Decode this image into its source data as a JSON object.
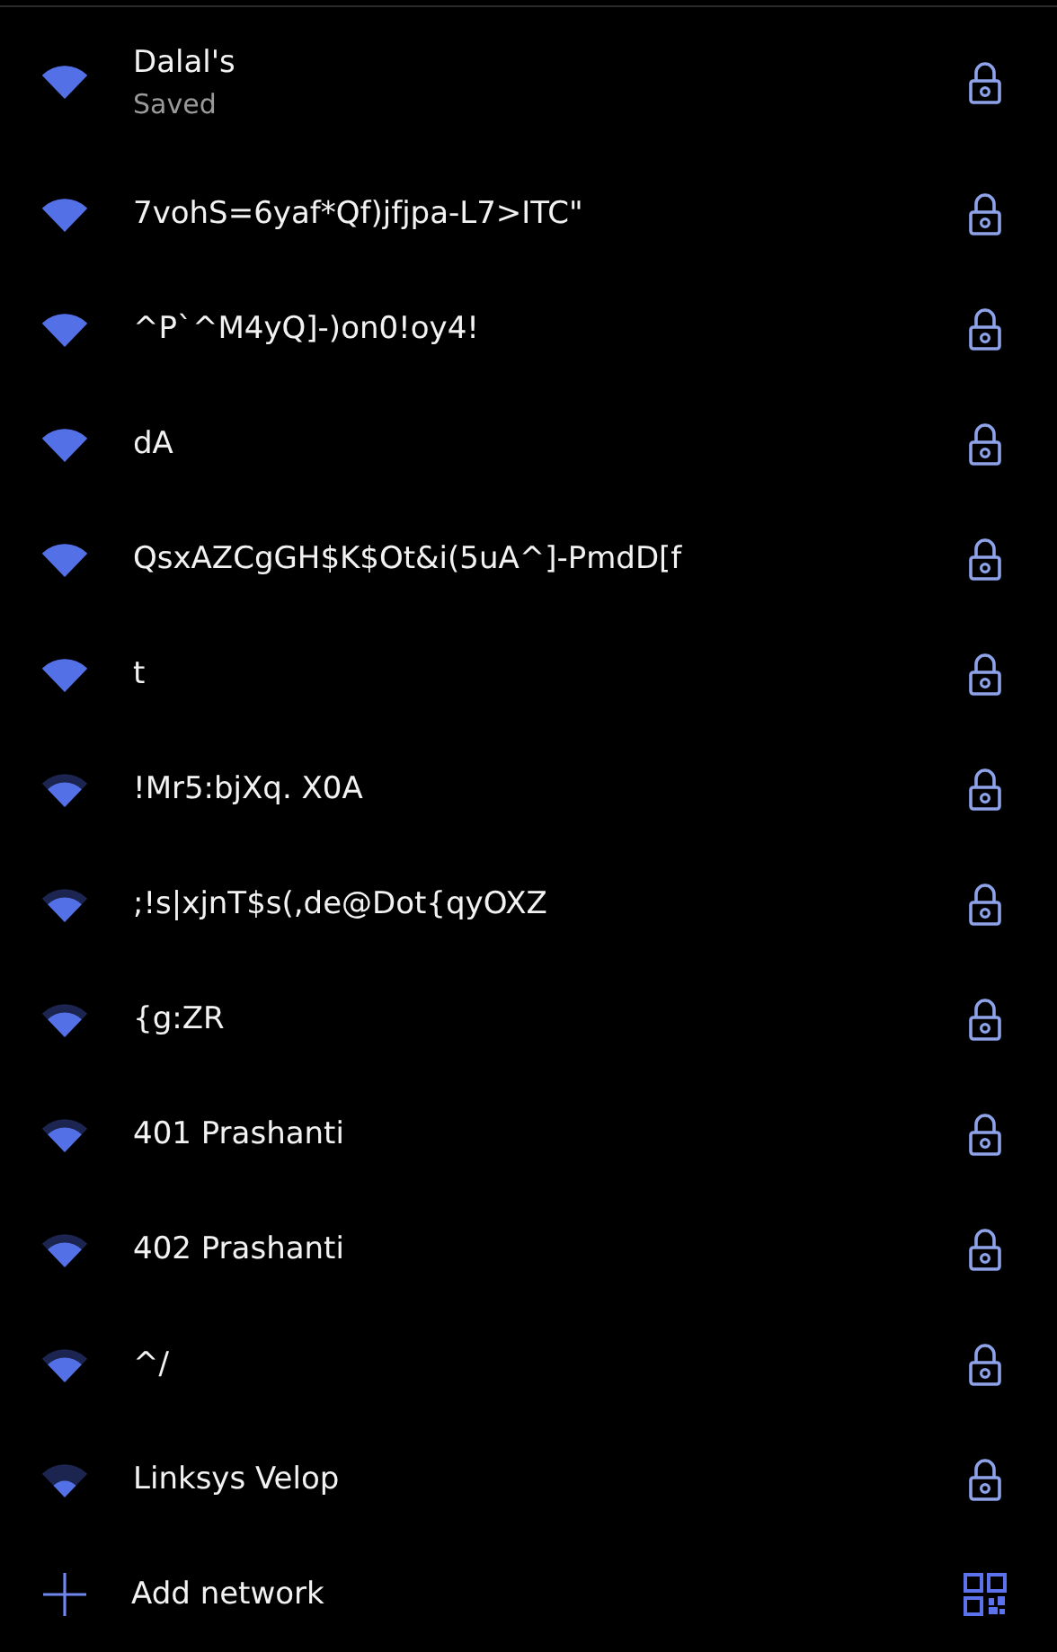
{
  "networks": [
    {
      "name": "Dalal's",
      "status": "Saved",
      "kind": "strong",
      "secured": true
    },
    {
      "name": "7vohS=6yaf*Qf)jfjpa-L7>ITC\"",
      "kind": "strong",
      "secured": true
    },
    {
      "name": "^P`^M4yQ]-)on0!oy4!",
      "kind": "strong",
      "secured": true
    },
    {
      "name": "dA",
      "kind": "strong",
      "secured": true
    },
    {
      "name": "QsxAZCgGH$K$Ot&i(5uA^]-PmdD[f",
      "kind": "strong",
      "secured": true
    },
    {
      "name": "t",
      "kind": "strong",
      "secured": true
    },
    {
      "name": "!Mr5:bjXq. X0A",
      "kind": "medium",
      "secured": true
    },
    {
      "name": ";!s|xjnT$s(,de@Dot{qyOXZ",
      "kind": "medium",
      "secured": true
    },
    {
      "name": "{g:ZR",
      "kind": "medium",
      "secured": true
    },
    {
      "name": "401 Prashanti",
      "kind": "medium",
      "secured": true
    },
    {
      "name": "402 Prashanti",
      "kind": "medium",
      "secured": true
    },
    {
      "name": "^/",
      "kind": "medium",
      "secured": true
    },
    {
      "name": "Linksys Velop",
      "kind": "weak",
      "secured": true
    }
  ],
  "add_network": {
    "label": "Add network"
  }
}
